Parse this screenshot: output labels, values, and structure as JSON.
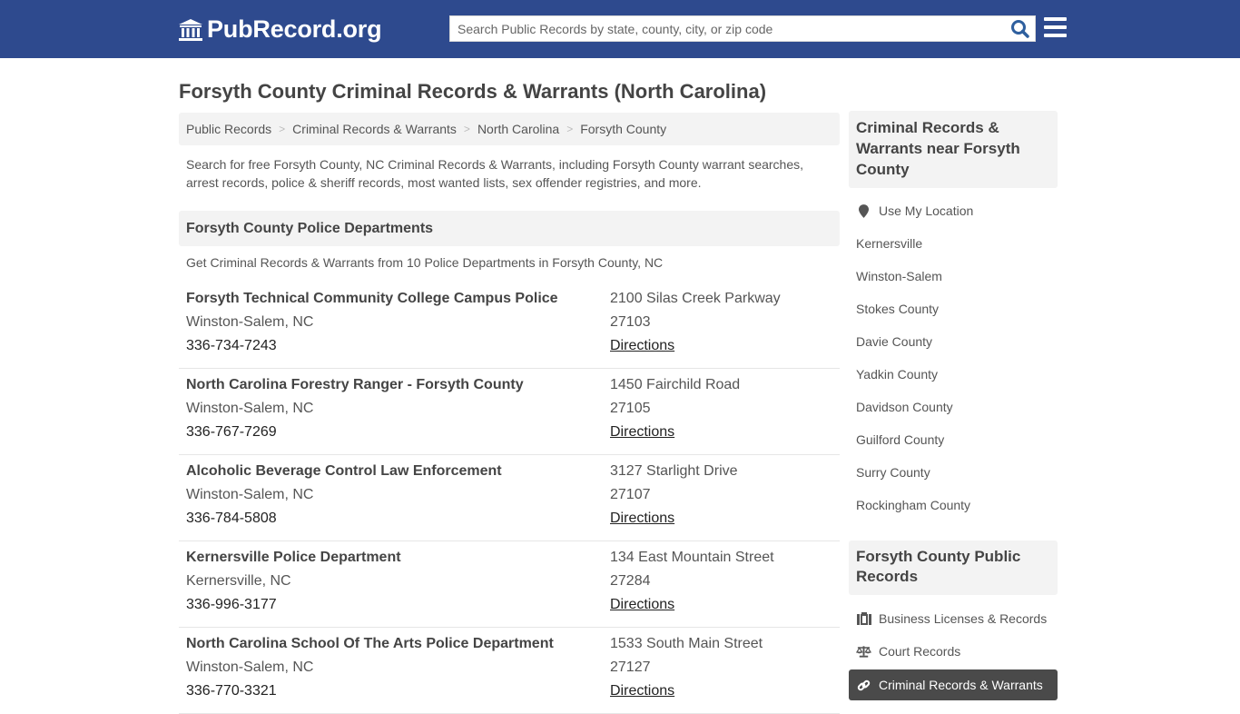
{
  "header": {
    "logo_text": "PubRecord.org",
    "search_placeholder": "Search Public Records by state, county, city, or zip code",
    "search_value": "",
    "brand_color": "#2e4a8e",
    "icons": {
      "logo": "courthouse-icon",
      "search": "search-icon",
      "menu": "hamburger-menu-icon"
    }
  },
  "page": {
    "title": "Forsyth County Criminal Records & Warrants (North Carolina)",
    "breadcrumb": [
      "Public Records",
      "Criminal Records & Warrants",
      "North Carolina",
      "Forsyth County"
    ],
    "intro": "Search for free Forsyth County, NC Criminal Records & Warrants, including Forsyth County warrant searches, arrest records, police & sheriff records, most wanted lists, sex offender registries, and more."
  },
  "departments_section": {
    "heading": "Forsyth County Police Departments",
    "subheading": "Get Criminal Records & Warrants from 10 Police Departments in Forsyth County, NC",
    "directions_label": "Directions",
    "items": [
      {
        "name": "Forsyth Technical Community College Campus Police",
        "city": "Winston-Salem, NC",
        "phone": "336-734-7243",
        "address": "2100 Silas Creek Parkway",
        "zip": "27103"
      },
      {
        "name": "North Carolina Forestry Ranger - Forsyth County",
        "city": "Winston-Salem, NC",
        "phone": "336-767-7269",
        "address": "1450 Fairchild Road",
        "zip": "27105"
      },
      {
        "name": "Alcoholic Beverage Control Law Enforcement",
        "city": "Winston-Salem, NC",
        "phone": "336-784-5808",
        "address": "3127 Starlight Drive",
        "zip": "27107"
      },
      {
        "name": "Kernersville Police Department",
        "city": "Kernersville, NC",
        "phone": "336-996-3177",
        "address": "134 East Mountain Street",
        "zip": "27284"
      },
      {
        "name": "North Carolina School Of The Arts Police Department",
        "city": "Winston-Salem, NC",
        "phone": "336-770-3321",
        "address": "1533 South Main Street",
        "zip": "27127"
      }
    ]
  },
  "sidebar": {
    "nearby_heading": "Criminal Records & Warrants near Forsyth County",
    "use_location_label": "Use My Location",
    "nearby": [
      "Kernersville",
      "Winston-Salem",
      "Stokes County",
      "Davie County",
      "Yadkin County",
      "Davidson County",
      "Guilford County",
      "Surry County",
      "Rockingham County"
    ],
    "public_records_heading": "Forsyth County Public Records",
    "categories": [
      {
        "label": "Business Licenses & Records",
        "icon": "briefcase-icon",
        "active": false
      },
      {
        "label": "Court Records",
        "icon": "balance-scale-icon",
        "active": false
      },
      {
        "label": "Criminal Records & Warrants",
        "icon": "link-icon",
        "active": true
      }
    ]
  }
}
